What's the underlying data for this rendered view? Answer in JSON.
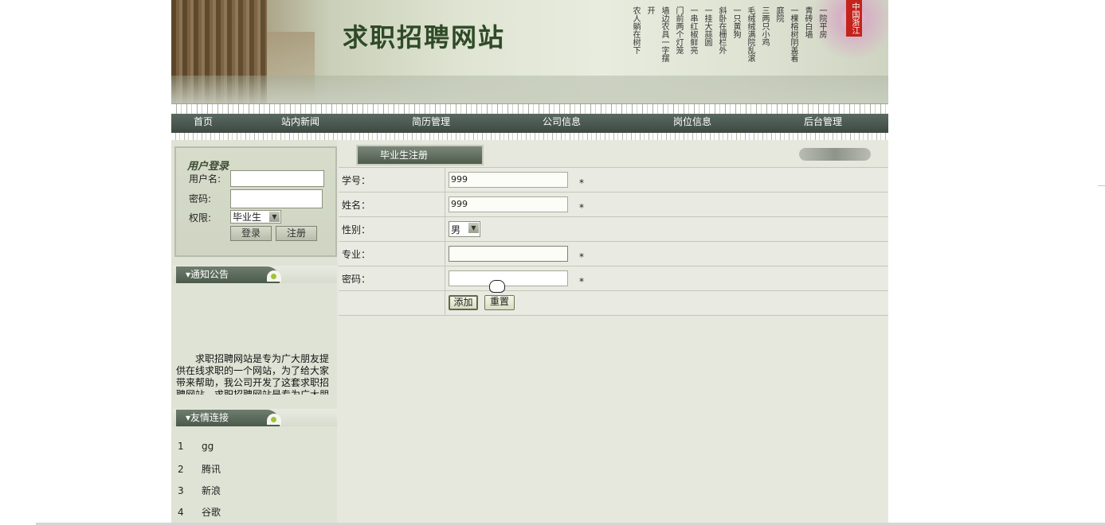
{
  "header": {
    "site_title": "求职招聘网站",
    "seal_text": "中国浙江",
    "poem_columns": [
      "一院平房",
      "青砖白墙",
      "一棵榕树阴盖着",
      "庭院",
      "三两只小鸡",
      "毛绒绒满院乱滚",
      "一只黄狗",
      "斜卧在栅栏外",
      "一挂大蒜圆",
      "一串红椒鲜亮",
      "门前两个灯笼",
      "墙边农具一字摆",
      "开",
      "农人躺在树下"
    ]
  },
  "nav": [
    "首页",
    "站内新闻",
    "简历管理",
    "公司信息",
    "岗位信息",
    "后台管理"
  ],
  "sidebar": {
    "login": {
      "title": "用户登录",
      "username_label": "用户名:",
      "password_label": "密码:",
      "role_label": "权限:",
      "role_value": "毕业生",
      "login_button": "登录",
      "register_button": "注册"
    },
    "notice": {
      "title": "通知公告",
      "text": "求职招聘网站是专为广大朋友提供在线求职的一个网站，为了给大家带来帮助，我公司开发了这套求职招聘网站。求职招聘网站是专为广大朋"
    },
    "links": {
      "title": "友情连接",
      "items": [
        {
          "num": "1",
          "name": "gg"
        },
        {
          "num": "2",
          "name": "腾讯"
        },
        {
          "num": "3",
          "name": "新浪"
        },
        {
          "num": "4",
          "name": "谷歌"
        }
      ]
    }
  },
  "main": {
    "tab_title": "毕业生注册",
    "form": {
      "student_id": {
        "label": "学号：",
        "value": "999"
      },
      "name": {
        "label": "姓名：",
        "value": "999"
      },
      "gender": {
        "label": "性别：",
        "value": "男"
      },
      "major": {
        "label": "专业：",
        "value": ""
      },
      "password": {
        "label": "密码：",
        "value": ""
      },
      "required_mark": "*",
      "add_button": "添加",
      "reset_button": "重置"
    }
  }
}
